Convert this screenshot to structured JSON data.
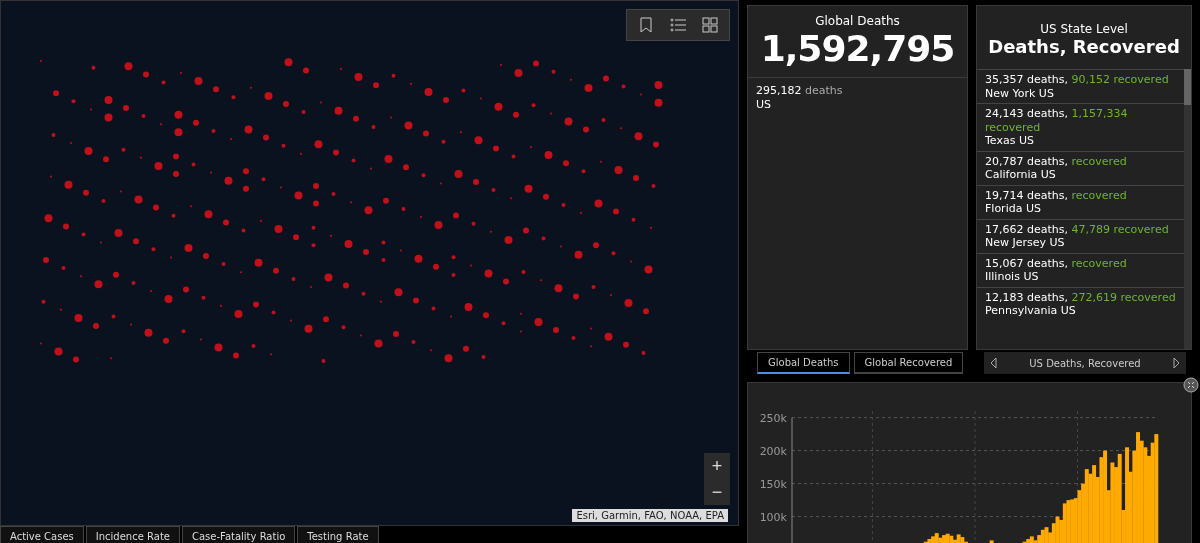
{
  "map": {
    "attribution": "Esri, Garmin, FAO, NOAA, EPA",
    "zoom_in": "+",
    "zoom_out": "−"
  },
  "map_tabs": [
    {
      "label": "Active Cases",
      "selected": false
    },
    {
      "label": "Incidence Rate",
      "selected": false
    },
    {
      "label": "Case-Fatality Ratio",
      "selected": false
    },
    {
      "label": "Testing Rate",
      "selected": false
    }
  ],
  "global_deaths": {
    "title": "Global Deaths",
    "total": "1,592,795",
    "items": [
      {
        "count": "295,182",
        "unit": "deaths",
        "place": "US"
      }
    ]
  },
  "global_tabs": [
    {
      "label": "Global Deaths",
      "selected": true
    },
    {
      "label": "Global Recovered",
      "selected": false
    }
  ],
  "us_state": {
    "subtitle": "US State Level",
    "title": "Deaths, Recovered",
    "items": [
      {
        "deaths": "35,357",
        "deaths_label": "deaths,",
        "recovered": "90,152",
        "recovered_label": "recovered",
        "place": "New York US"
      },
      {
        "deaths": "24,143",
        "deaths_label": "deaths,",
        "recovered": "1,157,334",
        "recovered_label": "recovered",
        "place": "Texas US"
      },
      {
        "deaths": "20,787",
        "deaths_label": "deaths,",
        "recovered_label": "recovered",
        "place": "California US"
      },
      {
        "deaths": "19,714",
        "deaths_label": "deaths,",
        "recovered_label": "recovered",
        "place": "Florida US"
      },
      {
        "deaths": "17,662",
        "deaths_label": "deaths,",
        "recovered": "47,789",
        "recovered_label": "recovered",
        "place": "New Jersey US"
      },
      {
        "deaths": "15,067",
        "deaths_label": "deaths,",
        "recovered_label": "recovered",
        "place": "Illinois US"
      },
      {
        "deaths": "12,183",
        "deaths_label": "deaths,",
        "recovered": "272,619",
        "recovered_label": "recovered",
        "place": "Pennsylvania US"
      }
    ]
  },
  "us_nav": {
    "label": "US Deaths, Recovered"
  },
  "chart": {
    "chart_data": {
      "type": "bar",
      "ylim": [
        60000,
        260000
      ],
      "yticks": [
        {
          "value": 100000,
          "label": "100k"
        },
        {
          "value": 150000,
          "label": "150k"
        },
        {
          "value": 200000,
          "label": "200k"
        },
        {
          "value": 250000,
          "label": "250k"
        }
      ],
      "grid": true,
      "series": [
        {
          "color": "#ffaa00",
          "values": [
            null,
            null,
            null,
            null,
            null,
            null,
            null,
            null,
            null,
            null,
            null,
            null,
            null,
            null,
            null,
            null,
            null,
            null,
            null,
            null,
            null,
            null,
            null,
            null,
            null,
            null,
            null,
            null,
            null,
            null,
            null,
            null,
            null,
            null,
            null,
            null,
            62000,
            66000,
            70000,
            75000,
            68000,
            72000,
            74000,
            71000,
            65000,
            73000,
            69000,
            62000,
            null,
            null,
            null,
            null,
            null,
            null,
            64000,
            null,
            null,
            null,
            null,
            null,
            null,
            null,
            null,
            62000,
            66000,
            70000,
            64000,
            72000,
            80000,
            84000,
            76000,
            90000,
            100000,
            95000,
            120000,
            125000,
            126000,
            128000,
            140000,
            150000,
            172000,
            165000,
            178000,
            160000,
            190000,
            200000,
            140000,
            182000,
            175000,
            195000,
            110000,
            205000,
            168000,
            200000,
            228000,
            215000,
            205000,
            192000,
            212000,
            225000
          ]
        }
      ]
    }
  }
}
